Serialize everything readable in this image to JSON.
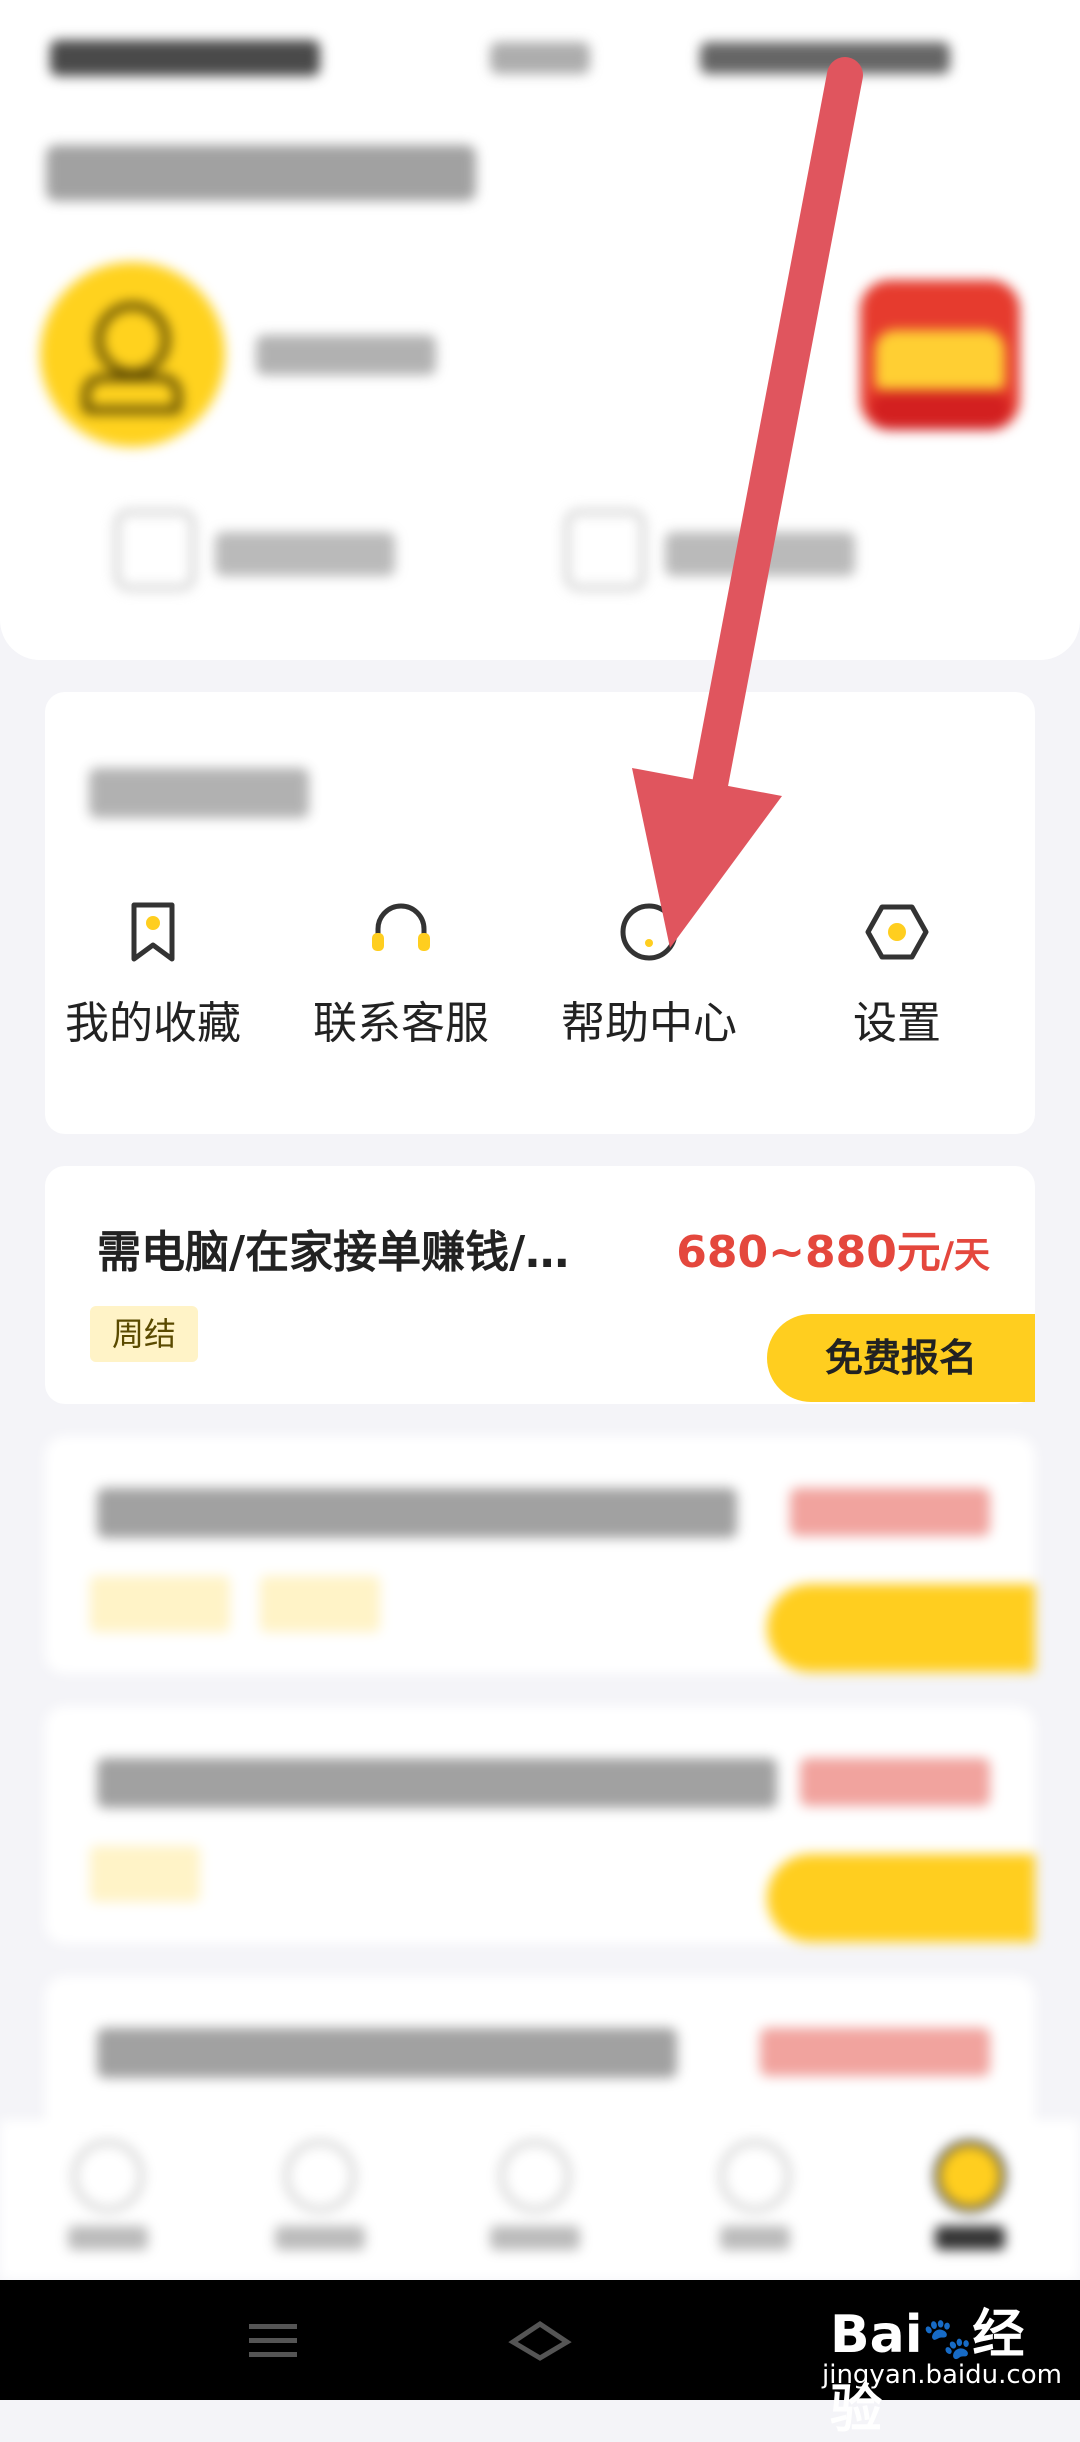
{
  "status_bar": {
    "left": "",
    "time": "",
    "right": ""
  },
  "profile": {
    "page_title": "",
    "user_id": "",
    "quick_links": [
      {
        "label": ""
      },
      {
        "label": ""
      }
    ]
  },
  "services": {
    "title": "",
    "items": [
      {
        "label": "我的收藏",
        "icon": "bookmark-icon"
      },
      {
        "label": "联系客服",
        "icon": "headset-icon"
      },
      {
        "label": "帮助中心",
        "icon": "help-icon"
      },
      {
        "label": "设置",
        "icon": "gear-icon"
      }
    ]
  },
  "jobs": [
    {
      "title": "需电脑/在家接单赚钱/…",
      "salary": "680~880元",
      "unit": "/天",
      "tags": [
        "周结"
      ],
      "apply_label": "免费报名"
    }
  ],
  "colors": {
    "accent": "#ffce1f",
    "salary": "#e4473d",
    "arrow": "#e0555e",
    "tag_bg": "#fff3c7"
  }
}
